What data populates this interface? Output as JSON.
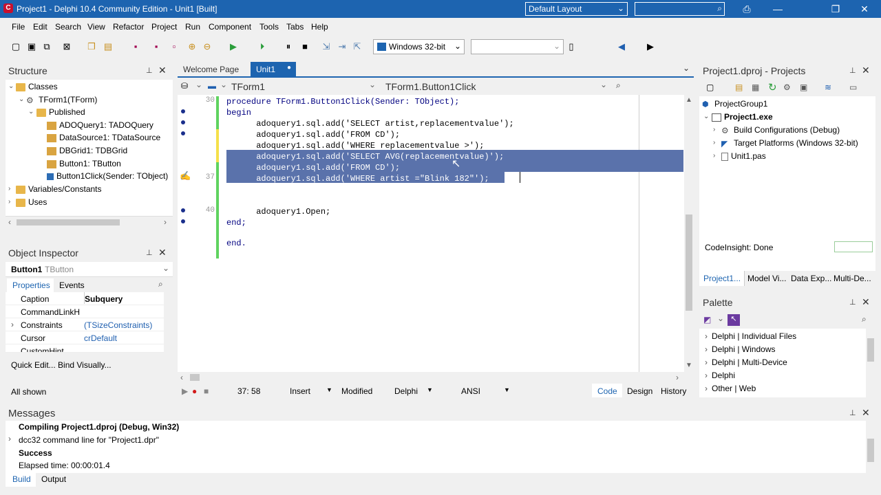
{
  "window": {
    "title": "Project1 - Delphi 10.4 Community Edition - Unit1 [Built]",
    "layout": "Default Layout"
  },
  "menu": [
    "File",
    "Edit",
    "Search",
    "View",
    "Refactor",
    "Project",
    "Run",
    "Component",
    "Tools",
    "Tabs",
    "Help"
  ],
  "toolbar": {
    "platform": "Windows 32-bit",
    "config": ""
  },
  "structure": {
    "title": "Structure",
    "nodes": [
      "Classes",
      "TForm1(TForm)",
      "Published",
      "ADOQuery1: TADOQuery",
      "DataSource1: TDataSource",
      "DBGrid1: TDBGrid",
      "Button1: TButton",
      "Button1Click(Sender: TObject)",
      "Variables/Constants",
      "Uses"
    ]
  },
  "inspector": {
    "title": "Object Inspector",
    "component": "Button1",
    "component_type": "TButton",
    "tabs": [
      "Properties",
      "Events"
    ],
    "rows": [
      {
        "k": "Caption",
        "v": "Subquery"
      },
      {
        "k": "CommandLinkH",
        "v": ""
      },
      {
        "k": "Constraints",
        "v": "(TSizeConstraints)"
      },
      {
        "k": "Cursor",
        "v": "crDefault"
      },
      {
        "k": "CustomHint",
        "v": ""
      }
    ],
    "links": "Quick Edit... Bind Visually...",
    "footer": "All shown"
  },
  "editor": {
    "tabs": [
      "Welcome Page",
      "Unit1"
    ],
    "class_combo": "TForm1",
    "method_combo": "TForm1.Button1Click",
    "line_numbers": [
      "30",
      "37",
      "40"
    ],
    "lines": [
      "procedure TForm1.Button1Click(Sender: TObject);",
      "begin",
      "      adoquery1.sql.add('SELECT artist,replacementvalue');",
      "      adoquery1.sql.add('FROM CD');",
      "      adoquery1.sql.add('WHERE replacementvalue >');",
      "      adoquery1.sql.add('SELECT AVG(replacementvalue)');",
      "      adoquery1.sql.add('FROM CD');",
      "      adoquery1.sql.add('WHERE artist =\"Blink 182\"');",
      "      adoquery1.Open;",
      "end;",
      "end."
    ],
    "status": {
      "pos": "37: 58",
      "mode": "Insert",
      "modified": "Modified",
      "lang": "Delphi",
      "enc": "ANSI"
    },
    "view_tabs": [
      "Code",
      "Design",
      "History"
    ]
  },
  "projects": {
    "title": "Project1.dproj - Projects",
    "nodes": [
      "ProjectGroup1",
      "Project1.exe",
      "Build Configurations (Debug)",
      "Target Platforms (Windows 32-bit)",
      "Unit1.pas"
    ],
    "codeinsight": "CodeInsight: Done",
    "tabs": [
      "Project1...",
      "Model Vi...",
      "Data Exp...",
      "Multi-De..."
    ]
  },
  "palette": {
    "title": "Palette",
    "items": [
      "Delphi | Individual Files",
      "Delphi | Windows",
      "Delphi | Multi-Device",
      "Delphi",
      "Other | Web"
    ]
  },
  "messages": {
    "title": "Messages",
    "lines": [
      "Compiling Project1.dproj (Debug, Win32)",
      "dcc32 command line for \"Project1.dpr\"",
      "Success",
      "Elapsed time: 00:00:01.4"
    ],
    "tabs": [
      "Build",
      "Output"
    ]
  }
}
